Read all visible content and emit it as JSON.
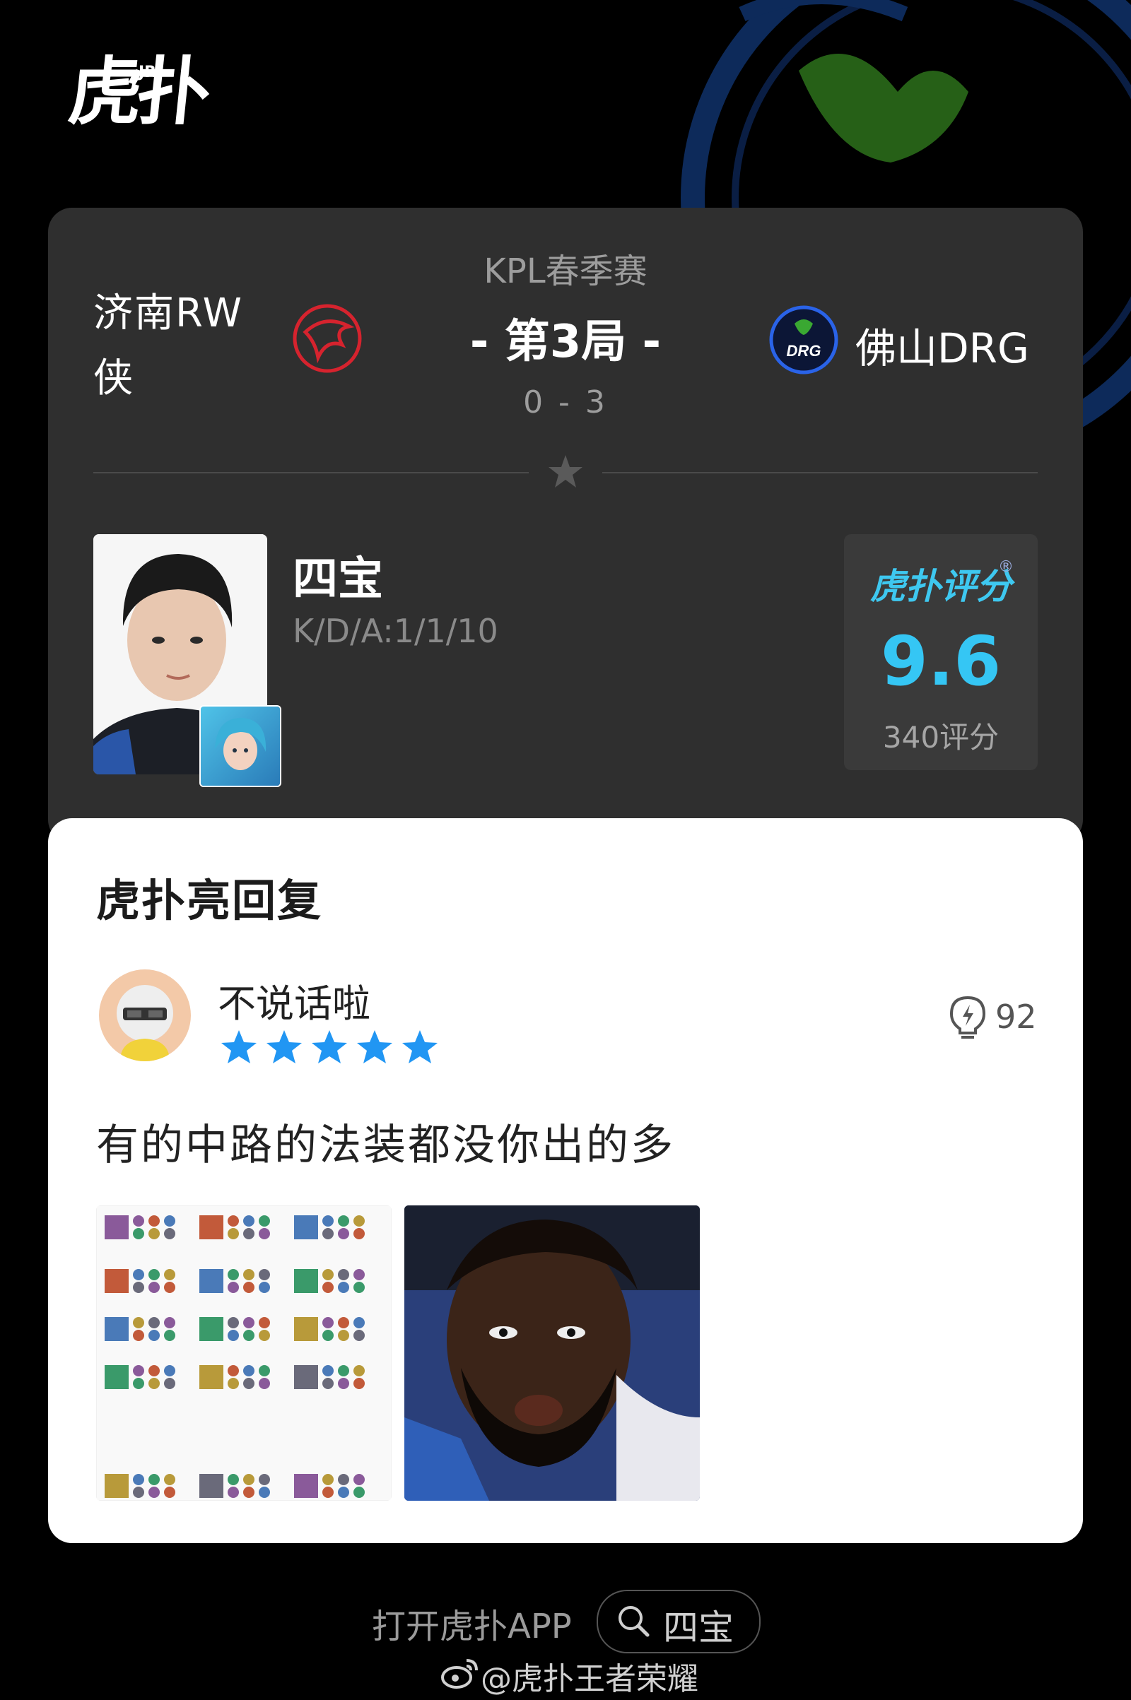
{
  "brand": {
    "logo_text": "虎扑",
    "logo_sup": "JR"
  },
  "match": {
    "league": "KPL春季赛",
    "round": "- 第3局 -",
    "score": "0 - 3",
    "team_left": {
      "name": "济南RW侠",
      "accent": "#d6232e"
    },
    "team_right": {
      "name": "佛山DRG",
      "logo_text": "DRG",
      "accent": "#2a63e8"
    }
  },
  "player": {
    "name": "四宝",
    "kda": "K/D/A:1/1/10"
  },
  "rating": {
    "brand": "虎扑评分",
    "registered": "®",
    "score": "9.6",
    "count": "340评分",
    "accent": "#35c6f4"
  },
  "reply": {
    "title": "虎扑亮回复",
    "user_name": "不说话啦",
    "stars": 5,
    "star_color": "#2196f3",
    "light_count": "92",
    "comment": "有的中路的法装都没你出的多",
    "images": [
      "build-screenshot",
      "reaction-photo"
    ]
  },
  "footer": {
    "open_app": "打开虎扑APP",
    "search_term": "四宝",
    "weibo_handle": "@虎扑王者荣耀"
  }
}
